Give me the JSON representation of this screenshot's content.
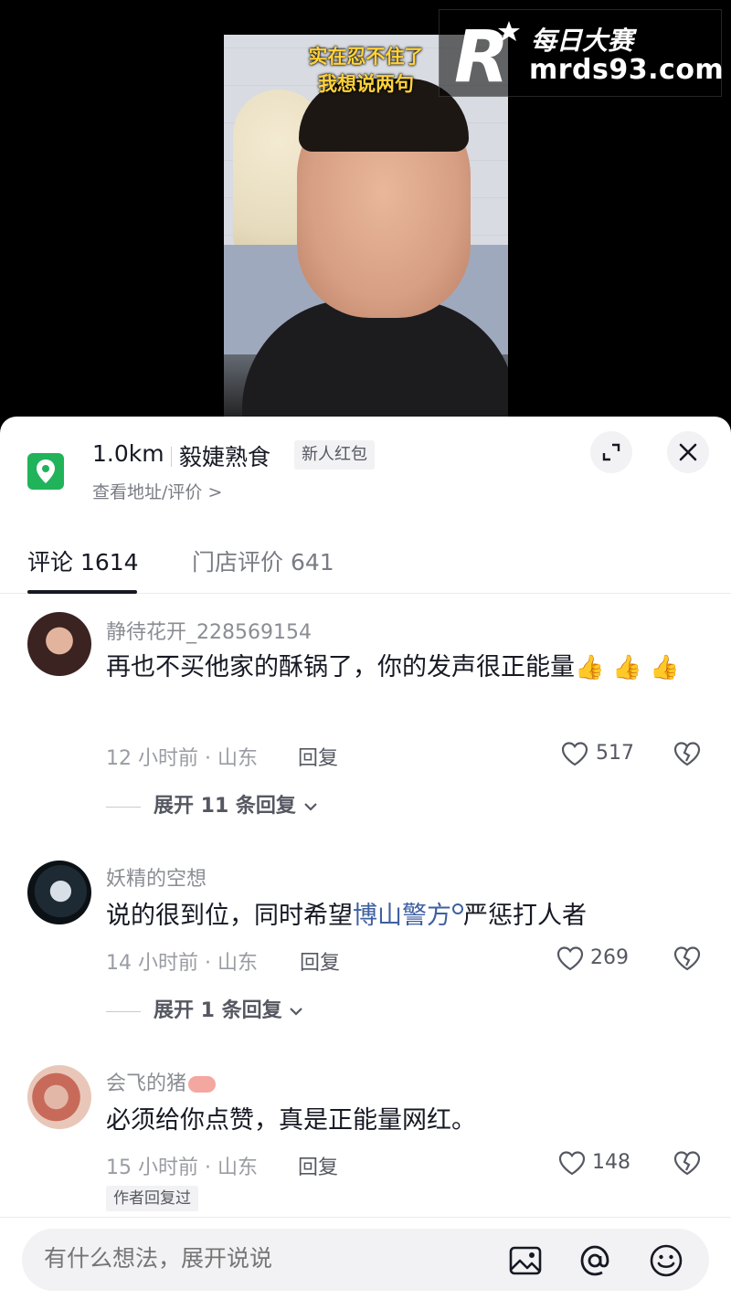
{
  "video": {
    "caption_line1": "实在忍不住了",
    "caption_line2": "我想说两句"
  },
  "watermark": {
    "brand": "每日大赛",
    "url": "mrds93.com"
  },
  "shop": {
    "distance": "1.0km",
    "name": "毅婕熟食",
    "badge": "新人红包",
    "address_link": "查看地址/评价 >"
  },
  "tabs": [
    {
      "label": "评论 1614",
      "active": true
    },
    {
      "label": "门店评价 641",
      "active": false
    }
  ],
  "comments": [
    {
      "username": "静待花开_228569154",
      "text": "再也不买他家的酥锅了，你的发声很正能量",
      "emoji": "👍",
      "meta": "12 小时前 · 山东",
      "reply_label": "回复",
      "likes": "517",
      "expand": "展开 11 条回复"
    },
    {
      "username": "妖精的空想",
      "text_before": "说的很到位，同时希望",
      "link": "博山警方",
      "text_after": "严惩打人者",
      "meta": "14 小时前 · 山东",
      "reply_label": "回复",
      "likes": "269",
      "expand": "展开 1 条回复"
    },
    {
      "username": "会飞的猪",
      "text": "必须给你点赞，真是正能量网红。",
      "meta": "15 小时前 · 山东",
      "reply_label": "回复",
      "likes": "148",
      "author_badge": "作者回复过"
    }
  ],
  "input": {
    "placeholder": "有什么想法，展开说说"
  },
  "colors": {
    "accent_green": "#21b35a",
    "link_blue": "#3f5fa1",
    "caption_yellow": "#ffd23a"
  },
  "icons": [
    "location-pin-icon",
    "expand-icon",
    "close-icon",
    "heart-icon",
    "dislike-heart-icon",
    "image-icon",
    "at-icon",
    "emoji-icon",
    "chevron-down-icon"
  ]
}
